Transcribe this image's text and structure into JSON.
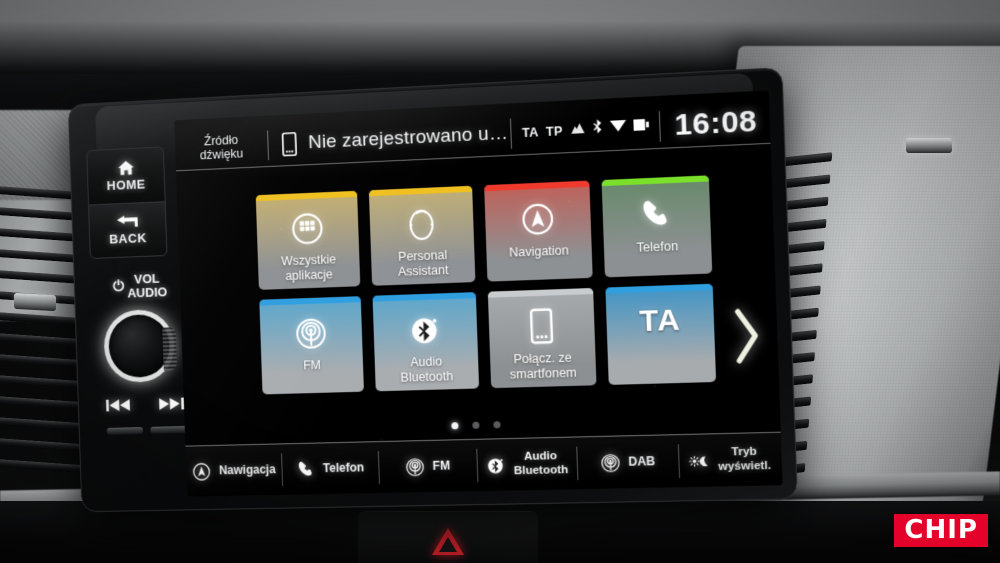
{
  "device": {
    "name": "Honda infotainment head unit",
    "hardkeys": [
      {
        "label": "HOME",
        "icon": "home-icon"
      },
      {
        "label": "BACK",
        "icon": "back-arrow-icon"
      }
    ],
    "volume_knob": {
      "line1": "VOL",
      "line2": "AUDIO",
      "power_glyph": "⏻",
      "icon": "power-icon"
    },
    "transport": {
      "prev_icon": "skip-previous-icon",
      "next_icon": "skip-next-icon"
    }
  },
  "statusbar": {
    "source_line1": "Źródło",
    "source_line2": "dźwięku",
    "phone_icon": "smartphone-icon",
    "message": "Nie zarejestrowano urząd...",
    "indicators": [
      {
        "name": "ta-indicator",
        "label": "TA"
      },
      {
        "name": "tp-indicator",
        "label": "TP"
      },
      {
        "name": "antenna-icon",
        "label": ""
      },
      {
        "name": "bluetooth-icon",
        "label": ""
      },
      {
        "name": "signal-bars-icon",
        "label": ""
      },
      {
        "name": "battery-icon",
        "label": ""
      }
    ],
    "time": "16:08"
  },
  "home": {
    "tiles": [
      {
        "label": "Wszystkie aplikacje",
        "label_l1": "Wszystkie",
        "label_l2": "aplikacje",
        "icon": "apps-grid-icon",
        "accent": "#f0c020",
        "body_top": "#c6b070",
        "body_bottom": "#8e9194"
      },
      {
        "label": "Personal Assistant",
        "label_l1": "Personal",
        "label_l2": "Assistant",
        "icon": "assistant-face-icon",
        "accent": "#f0c020",
        "body_top": "#c2b075",
        "body_bottom": "#8f9296"
      },
      {
        "label": "Navigation",
        "label_l1": "Navigation",
        "label_l2": "",
        "icon": "navigation-compass-icon",
        "accent": "#f03a2e",
        "body_top": "#c06058",
        "body_bottom": "#8e9194"
      },
      {
        "label": "Telefon",
        "label_l1": "Telefon",
        "label_l2": "",
        "icon": "phone-handset-icon",
        "accent": "#7ae02a",
        "body_top": "#67896a",
        "body_bottom": "#8d9093"
      },
      {
        "label": "FM",
        "label_l1": "FM",
        "label_l2": "",
        "icon": "radio-waves-icon",
        "accent": "#2f9fe0",
        "body_top": "#5aa6cc",
        "body_bottom": "#a9adb0"
      },
      {
        "label": "Audio Bluetooth",
        "label_l1": "Audio",
        "label_l2": "Bluetooth",
        "icon": "bluetooth-icon",
        "accent": "#2f9fe0",
        "body_top": "#5aa6cc",
        "body_bottom": "#a9adb0"
      },
      {
        "label": "Połącz. ze smartfonem",
        "label_l1": "Połącz. ze",
        "label_l2": "smartfonem",
        "icon": "smartphone-icon",
        "accent": "#c9ccce",
        "body_top": "#a8abad",
        "body_bottom": "#8d9092"
      },
      {
        "label": "TA",
        "label_l1": "TA",
        "label_l2": "",
        "icon": "none",
        "accent": "#2f9fe0",
        "body_top": "#3f94c6",
        "body_bottom": "#a7abae"
      }
    ],
    "next_page_icon": "chevron-right-icon",
    "pages": 3,
    "active_page": 1
  },
  "dock": {
    "items": [
      {
        "label": "Nawigacja",
        "label_l1": "Nawigacja",
        "label_l2": "",
        "icon": "navigation-compass-icon"
      },
      {
        "label": "Telefon",
        "label_l1": "Telefon",
        "label_l2": "",
        "icon": "phone-handset-icon"
      },
      {
        "label": "FM",
        "label_l1": "FM",
        "label_l2": "",
        "icon": "radio-waves-icon"
      },
      {
        "label": "Audio Bluetooth",
        "label_l1": "Audio",
        "label_l2": "Bluetooth",
        "icon": "bluetooth-icon"
      },
      {
        "label": "DAB",
        "label_l1": "DAB",
        "label_l2": "",
        "icon": "radio-waves-icon"
      },
      {
        "label": "Tryb wyświetl.",
        "label_l1": "Tryb",
        "label_l2": "wyświetl.",
        "icon": "day-night-icon"
      }
    ]
  },
  "watermark": {
    "text": "CHIP",
    "color": "#e4022a"
  },
  "car": {
    "hazard_button_icon": "hazard-triangle-icon"
  }
}
